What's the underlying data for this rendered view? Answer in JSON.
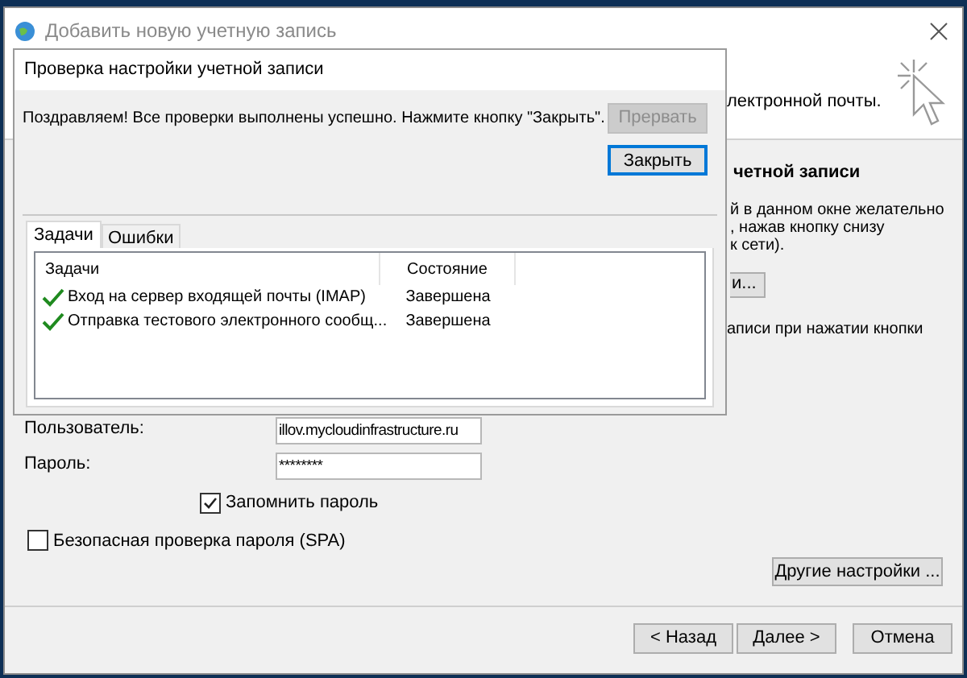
{
  "window": {
    "title": "Добавить новую учетную запись"
  },
  "header": {
    "text": "лектронной почты."
  },
  "right_panel": {
    "heading": "четной записи",
    "lines": [
      "й в данном окне желательно",
      ", нажав кнопку снизу",
      "к сети)."
    ],
    "button": "и...",
    "note": "аписи при нажатии кнопки"
  },
  "fields": [
    {
      "label": "Пользователь:",
      "value": "illov.mycloudinfrastructure.ru"
    },
    {
      "label": "Пароль:",
      "value": "********"
    }
  ],
  "checkboxes": [
    {
      "label": "Запомнить пароль",
      "checked": true,
      "indented": true
    },
    {
      "label": "Безопасная проверка пароля (SPA)",
      "checked": false,
      "indented": false
    }
  ],
  "more_button": "Другие настройки ...",
  "nav_buttons": [
    {
      "label": "< Назад"
    },
    {
      "label": "Далее >"
    },
    {
      "label": "Отмена"
    }
  ],
  "dialog": {
    "title": "Проверка настройки учетной записи",
    "message": "Поздравляем! Все проверки выполнены успешно. Нажмите кнопку \"Закрыть\".",
    "buttons": [
      {
        "label": "Прервать",
        "disabled": true
      },
      {
        "label": "Закрыть",
        "disabled": false
      }
    ],
    "tabs": [
      {
        "label": "Задачи",
        "selected": true
      },
      {
        "label": "Ошибки",
        "selected": false
      }
    ],
    "columns": [
      "Задачи",
      "Состояние"
    ],
    "rows": [
      {
        "task": "Вход на сервер входящей почты (IMAP)",
        "status": "Завершена",
        "done": true
      },
      {
        "task": "Отправка тестового электронного сообщ...",
        "status": "Завершена",
        "done": true
      }
    ]
  }
}
